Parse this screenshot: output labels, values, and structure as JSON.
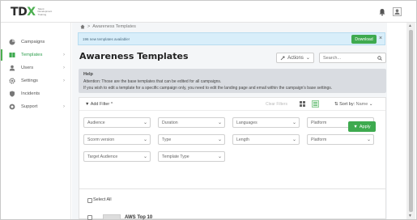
{
  "header": {
    "logo_text": "TDX",
    "logo_subtitle": "Talent Development Training"
  },
  "sidebar": {
    "items": [
      {
        "label": "Campaigns",
        "icon": "pie-chart-icon",
        "chevron": ""
      },
      {
        "label": "Templates",
        "icon": "book-icon",
        "chevron": "›"
      },
      {
        "label": "Users",
        "icon": "user-icon",
        "chevron": "›"
      },
      {
        "label": "Settings",
        "icon": "gear-icon",
        "chevron": "›"
      },
      {
        "label": "Incidents",
        "icon": "shield-icon",
        "chevron": ""
      },
      {
        "label": "Support",
        "icon": "lifebuoy-icon",
        "chevron": "›"
      }
    ]
  },
  "breadcrumb": {
    "current": "Awareness Templates"
  },
  "banner": {
    "text": "196 new templates available!",
    "download_label": "Download",
    "close": "×"
  },
  "page_title": "Awareness Templates",
  "actions_label": "Actions",
  "search": {
    "placeholder": "Search..."
  },
  "help": {
    "title": "Help",
    "line1": "Attention: Those are the base templates that can be edited for all campaigns.",
    "line2": "If you wish to edit a template for a specific campaign only, you need to edit the landing page and email within the campaign's base settings."
  },
  "filters": {
    "add_filter_label": "Add Filter",
    "clear_filters_label": "Clear Filters",
    "sort_by_label": "Sort by:",
    "sort_by_value": "Name",
    "row1": [
      "Audience",
      "Duration",
      "Languages",
      "Platform"
    ],
    "row2": [
      "Scorm version",
      "Type",
      "Length",
      "Platform"
    ],
    "row3": [
      "Target Audience",
      "Template Type"
    ],
    "apply_label": "Apply"
  },
  "list": {
    "select_all_label": "Select All",
    "first_row_name": "AWS Top 10"
  },
  "colors": {
    "accent": "#3eaa4f",
    "banner_bg": "#d8eefa",
    "help_bg": "#d9dce1"
  }
}
